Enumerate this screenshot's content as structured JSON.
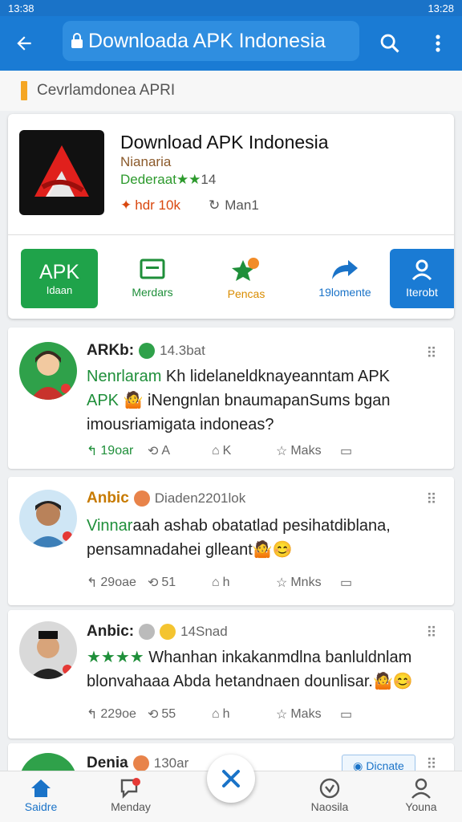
{
  "status_bar": {
    "time_left": "13:38",
    "time_right": "13:28"
  },
  "app_bar": {
    "url_text": "Downloada APK Indonesia"
  },
  "breadcrumb": {
    "text": "Cevrlamdonea APRI"
  },
  "app": {
    "title": "Download APK Indonesia",
    "developer": "Nianaria",
    "rating_label": "Dederaat",
    "rating_stars": "★★",
    "rating_count": "14",
    "downloads": "hdr 10k",
    "main_label": "Man1"
  },
  "actions": {
    "apk_title": "APK",
    "apk_sub": "Idaan",
    "version": "Merdars",
    "pencarian": "Pencas",
    "share": "19lomente",
    "interest": "Iterobt"
  },
  "posts": [
    {
      "name": "ARKb:",
      "meta": "14.3bat",
      "line1_green": "Nenrlaram",
      "line1": " Kh lidelaneldknayeanntam APK",
      "line2_green": "APK",
      "line2": " 🤷 iNengnlan bnaumapanSums bgan",
      "line3": "imousriamigata indoneas?",
      "likes": "19oar",
      "reposts": "A",
      "shares": "K",
      "marks": "Maks"
    },
    {
      "name": "Anbic",
      "meta": "Diaden2201lok",
      "line1_green": "Vinnar",
      "line1": "aah ashab obatatlad pesihatdiblana,",
      "line2": "pensamnadahei glleant🤷😊",
      "likes": "29oae",
      "reposts": "51",
      "shares": "h",
      "marks": "Mnks"
    },
    {
      "name": "Anbic:",
      "meta": "14Snad",
      "stars": "★★★★",
      "line1": " Whanhan inkakanmdlna banluldnlam",
      "line2": "blonvahaaa Abda hetandnaen dounlisar.🤷😊",
      "likes": "229oe",
      "reposts": "55",
      "shares": "h",
      "marks": "Maks"
    },
    {
      "name": "Denia",
      "meta": "130ar",
      "pill": "Dicnate"
    }
  ],
  "bottom_nav": {
    "home": "Saidre",
    "messages": "Menday",
    "center": "Naosila",
    "profile": "Youna"
  },
  "colors": {
    "primary": "#1a7bd4",
    "green": "#1fa34a",
    "orange": "#d98c00"
  }
}
